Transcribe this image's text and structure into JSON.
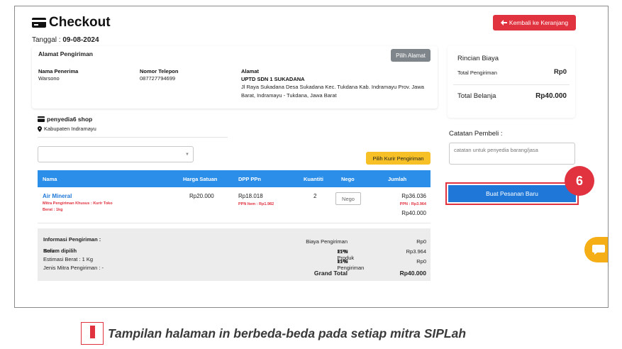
{
  "header": {
    "title": "Checkout",
    "date_prefix": "Tanggal : ",
    "date": "09-08-2024",
    "back_button": "Kembali ke Keranjang"
  },
  "address": {
    "heading": "Alamat Pengiriman",
    "change_button": "Pilih Alamat",
    "recipient_label": "Nama Penerima",
    "recipient": "Warsono",
    "phone_label": "Nomor Telepon",
    "phone": "087727794699",
    "address_label": "Alamat",
    "address_name": "UPTD SDN 1 SUKADANA",
    "address_line1": "Jl Raya Sukadana Desa Sukadana Kec. Tukdana Kab. Indramayu Prov. Jawa",
    "address_line2": "Barat, Indramayu - Tukdana, Jawa Barat"
  },
  "shop": {
    "name": "penyedia6 shop",
    "location": "Kabupaten Indramayu",
    "courier_select_value": "",
    "courier_button": "Pilih Kurir Pengiriman"
  },
  "table": {
    "headers": [
      "Nama",
      "Harga Satuan",
      "DPP PPn",
      "Kuantiti",
      "Nego",
      "Jumlah"
    ],
    "row": {
      "name": "Air Mineral",
      "shipping_note": "Mitra Pengiriman Khusus : Kurir Toko",
      "weight_note": "Berat : 1kg",
      "unit_price": "Rp20.000",
      "dpp": "Rp18.018",
      "ppn_item": "PPN Item : Rp1.982",
      "quantity": "2",
      "nego_placeholder": "Nego",
      "subtotal": "Rp36.036",
      "ppn": "PPN : Rp3.964",
      "total": "Rp40.000"
    }
  },
  "shipping_summary": {
    "heading": "Informasi Pengiriman :",
    "courier_label": "Kurir : ",
    "courier_value": "Belum dipilih",
    "weight": "Estimasi Berat : 1 Kg",
    "partner_type": "Jenis Mitra Pengiriman : -",
    "shipping_cost_label": "Biaya Pengiriman",
    "shipping_cost": "Rp0",
    "ppn_product_label": "PPN Produk ",
    "ppn_product_rate": "11%",
    "ppn_product": "Rp3.964",
    "ppn_shipping_label": "PPN Pengiriman ",
    "ppn_shipping_rate": "11%",
    "ppn_shipping": "Rp0",
    "grand_total_label": "Grand Total",
    "grand_total": "Rp40.000"
  },
  "sidebar": {
    "heading": "Rincian Biaya",
    "total_shipping_label": "Total Pengiriman",
    "total_shipping": "Rp0",
    "total_label": "Total Belanja",
    "total": "Rp40.000",
    "notes_label": "Catatan Pembeli :",
    "notes_placeholder": "catatan untuk penyedia barang/jasa",
    "submit_button": "Buat Pesanan Baru",
    "step_number": "6"
  },
  "caption": {
    "text": "Tampilan halaman in berbeda-beda pada setiap mitra SIPLah"
  },
  "colors": {
    "primary_blue": "#1f78d8",
    "table_header_blue": "#2b8ee8",
    "danger_red": "#e0323f",
    "warning_yellow": "#f6c026",
    "chat_orange": "#f5ae16"
  }
}
